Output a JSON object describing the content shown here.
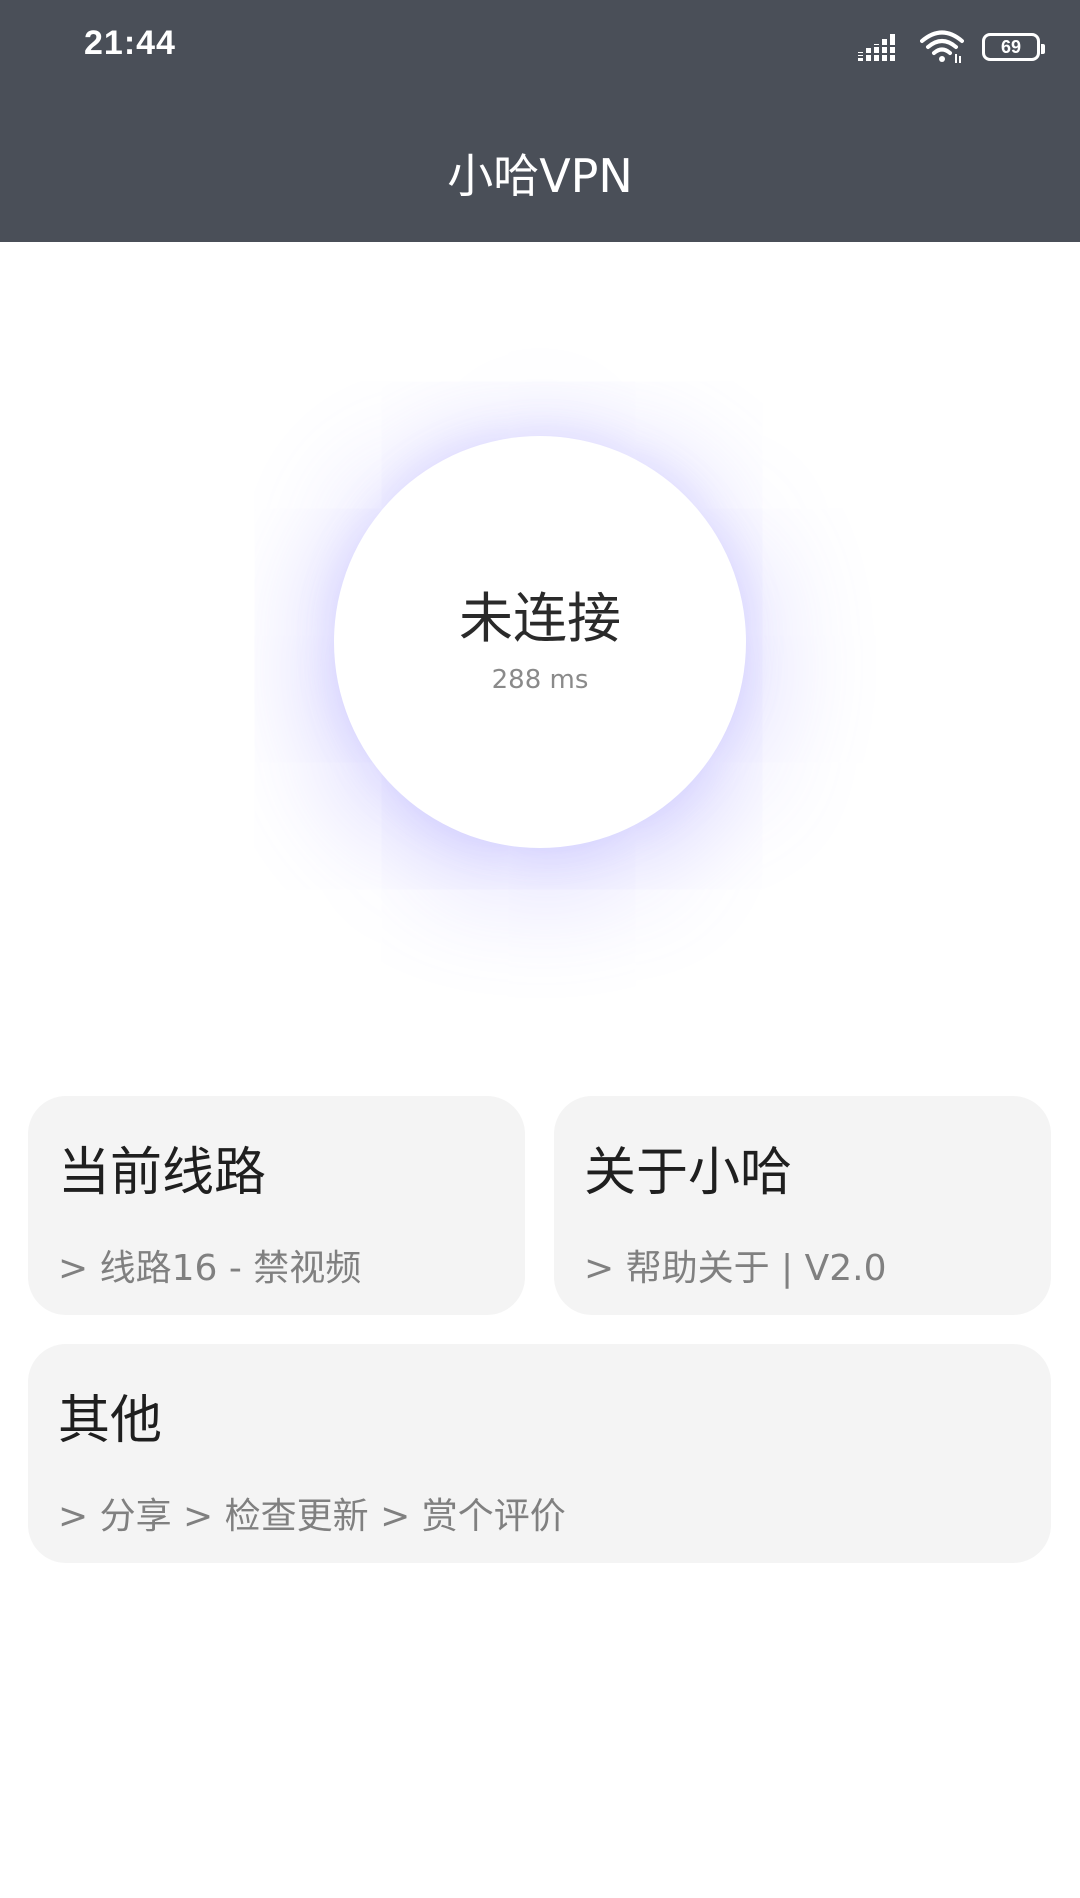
{
  "status_bar": {
    "time": "21:44",
    "signal_icon": "cellular-signal-icon",
    "wifi_icon": "wifi-icon",
    "battery_icon": "battery-icon",
    "battery_level": "69"
  },
  "header": {
    "title": "小哈VPN"
  },
  "connect": {
    "status": "未连接",
    "latency": "288 ms"
  },
  "cards": {
    "route": {
      "title": "当前线路",
      "subtitle": "> 线路16 - 禁视频"
    },
    "about": {
      "title": "关于小哈",
      "subtitle": "> 帮助关于 | V2.0"
    },
    "other": {
      "title": "其他",
      "subtitle": "> 分享 > 检查更新 > 赏个评价"
    }
  },
  "colors": {
    "header_bg": "#4a4f58",
    "card_bg": "#f4f4f4",
    "glow": "#786eff"
  }
}
